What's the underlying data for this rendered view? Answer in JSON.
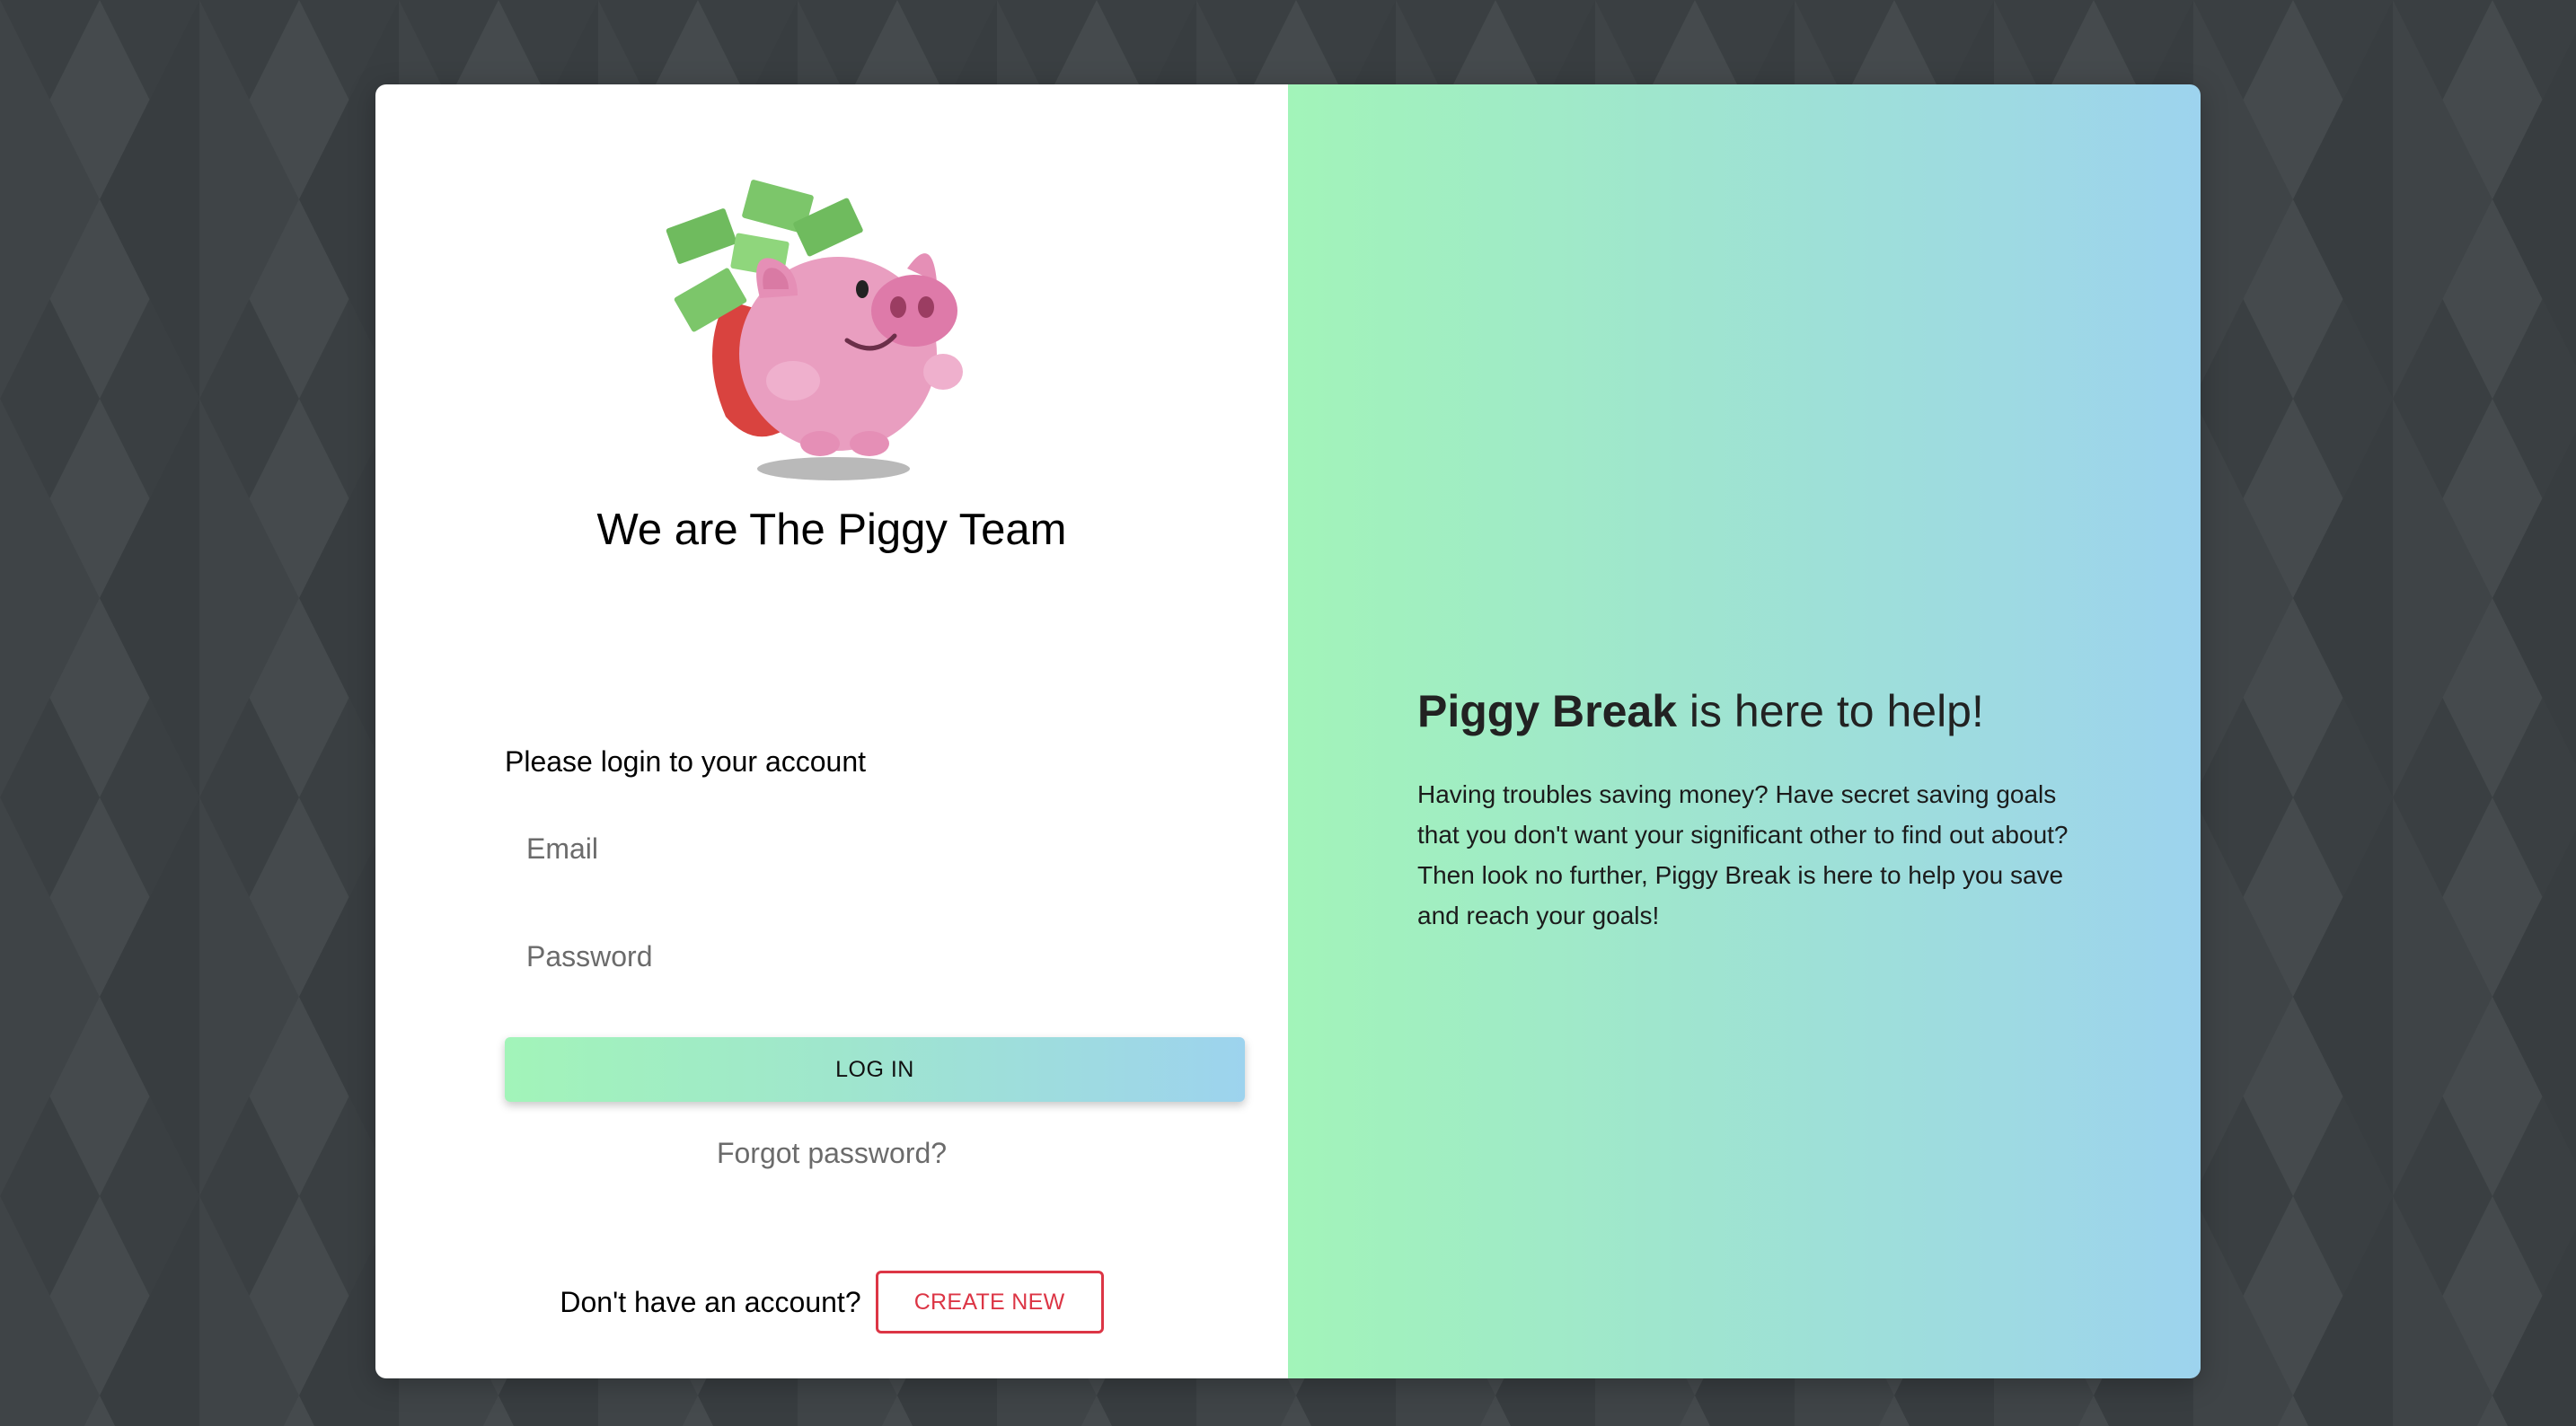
{
  "colors": {
    "page_background": "#3b4043",
    "accent_gradient_start": "#a2f4b9",
    "accent_gradient_end": "#9dd3ee",
    "create_button_color": "#dc3545"
  },
  "left": {
    "logo_icon": "piggy-bank-with-money-backpack-icon",
    "team_title": "We are The Piggy Team",
    "login_prompt": "Please login to your account",
    "email_placeholder": "Email",
    "password_placeholder": "Password",
    "login_button_label": "LOG IN",
    "forgot_password_label": "Forgot password?",
    "signup_text": "Don't have an account?",
    "create_button_label": "CREATE NEW"
  },
  "right": {
    "headline_brand": "Piggy Break",
    "headline_rest": " is here to help!",
    "description": "Having troubles saving money? Have secret saving goals that you don't want your significant other to find out about? Then look no further, Piggy Break is here to help you save and reach your goals!"
  }
}
